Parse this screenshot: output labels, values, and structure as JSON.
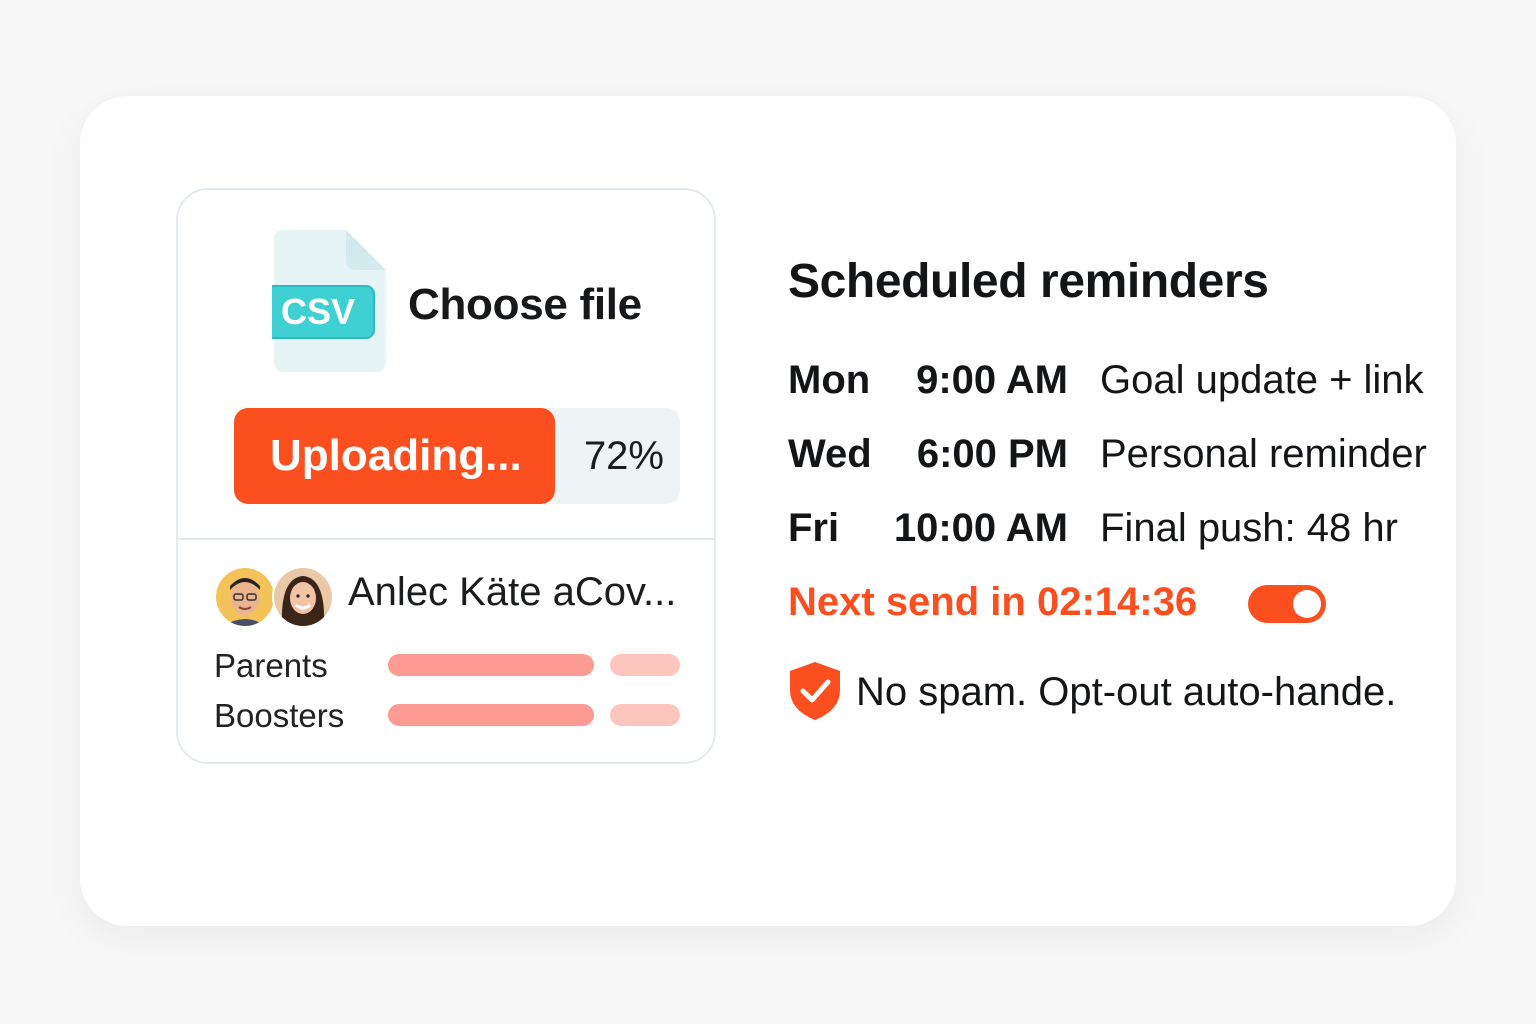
{
  "upload": {
    "file_badge": "CSV",
    "choose_label": "Choose file",
    "progress_label": "Uploading...",
    "progress_percent_text": "72%",
    "progress_value": 0.72,
    "accent_color": "#fb4f1f"
  },
  "recipients": {
    "names_text": "Anlec Käte aCov...",
    "groups": [
      {
        "label": "Parents"
      },
      {
        "label": "Boosters"
      }
    ]
  },
  "reminders": {
    "title": "Scheduled reminders",
    "items": [
      {
        "day": "Mon",
        "time": "9:00 AM",
        "description": "Goal update + link"
      },
      {
        "day": "Wed",
        "time": "6:00 PM",
        "description": "Personal reminder"
      },
      {
        "day": "Fri",
        "time": "10:00 AM",
        "description": "Final push: 48 hr"
      }
    ],
    "next_send": "Next send in 02:14:36",
    "toggle_on": true,
    "spam_note": "No spam. Opt-out auto-hande."
  },
  "icons": {
    "file": "csv-file-icon",
    "shield": "shield-check-icon",
    "avatar1": "avatar",
    "avatar2": "avatar"
  }
}
